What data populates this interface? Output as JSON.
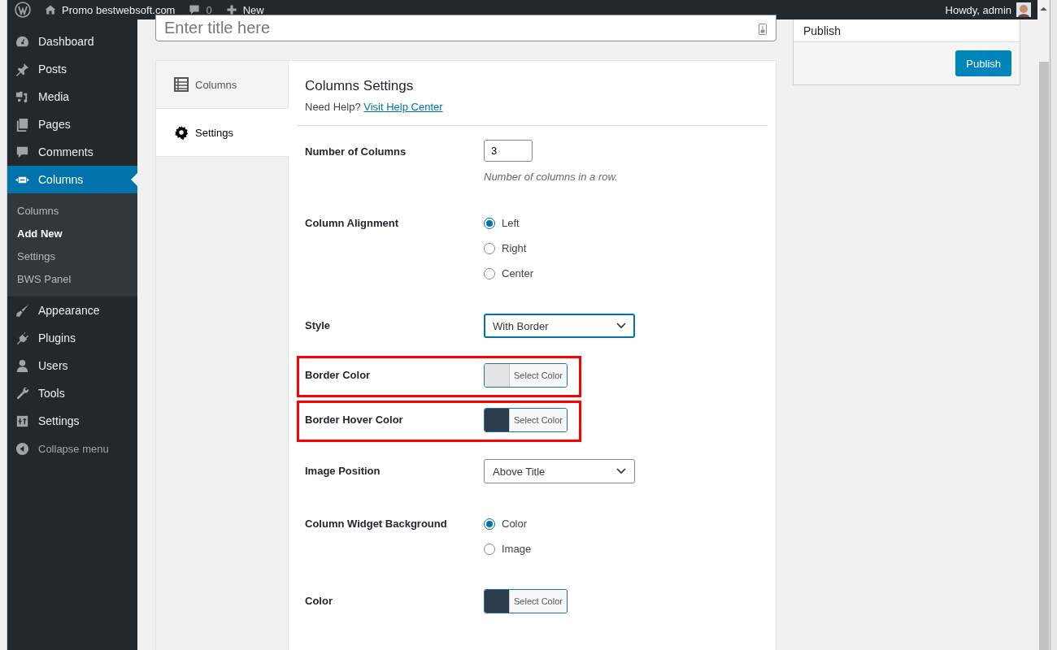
{
  "admin_bar": {
    "site": "Promo bestwebsoft.com",
    "comments": "0",
    "new": "New",
    "greeting": "Howdy, admin"
  },
  "sidebar": {
    "items": [
      {
        "label": "Dashboard",
        "selected": false
      },
      {
        "label": "Posts",
        "selected": false
      },
      {
        "label": "Media",
        "selected": false
      },
      {
        "label": "Pages",
        "selected": false
      },
      {
        "label": "Comments",
        "selected": false
      },
      {
        "label": "Columns",
        "selected": true,
        "children": [
          {
            "label": "Columns",
            "selected": false
          },
          {
            "label": "Add New",
            "selected": true
          },
          {
            "label": "Settings",
            "selected": false
          },
          {
            "label": "BWS Panel",
            "selected": false
          }
        ]
      },
      {
        "label": "Appearance",
        "selected": false
      },
      {
        "label": "Plugins",
        "selected": false
      },
      {
        "label": "Users",
        "selected": false
      },
      {
        "label": "Tools",
        "selected": false
      },
      {
        "label": "Settings",
        "selected": false
      }
    ],
    "collapse": "Collapse menu"
  },
  "title_field": {
    "placeholder": "Enter title here"
  },
  "tabs": [
    {
      "label": "Columns",
      "selected": false
    },
    {
      "label": "Settings",
      "selected": true
    }
  ],
  "panel": {
    "title": "Columns Settings",
    "help": "Need Help?",
    "help_link": "Visit Help Center"
  },
  "fields": [
    {
      "kind": "number",
      "label": "Number of Columns",
      "value": "3",
      "hint": "Number of columns in a row.",
      "highlighted": false
    },
    {
      "kind": "radio",
      "label": "Column Alignment",
      "highlighted": false,
      "options": [
        {
          "label": "Left",
          "selected": true
        },
        {
          "label": "Right",
          "selected": false
        },
        {
          "label": "Center",
          "selected": false
        }
      ]
    },
    {
      "kind": "select",
      "label": "Style",
      "value": "With Border",
      "focused": true,
      "highlighted": false
    },
    {
      "kind": "color",
      "label": "Border Color",
      "color": "#e5e5e5",
      "button": "Select Color",
      "highlighted": true
    },
    {
      "kind": "color",
      "label": "Border Hover Color",
      "color": "#2c3b4a",
      "button": "Select Color",
      "highlighted": true
    },
    {
      "kind": "select",
      "label": "Image Position",
      "value": "Above Title",
      "focused": false,
      "highlighted": false
    },
    {
      "kind": "radio",
      "label": "Column Widget Background",
      "highlighted": false,
      "options": [
        {
          "label": "Color",
          "selected": true
        },
        {
          "label": "Image",
          "selected": false
        }
      ]
    },
    {
      "kind": "color",
      "label": "Color",
      "color": "#2c3b4a",
      "button": "Select Color",
      "highlighted": false
    }
  ],
  "publish": {
    "title": "Publish",
    "button": "Publish"
  }
}
